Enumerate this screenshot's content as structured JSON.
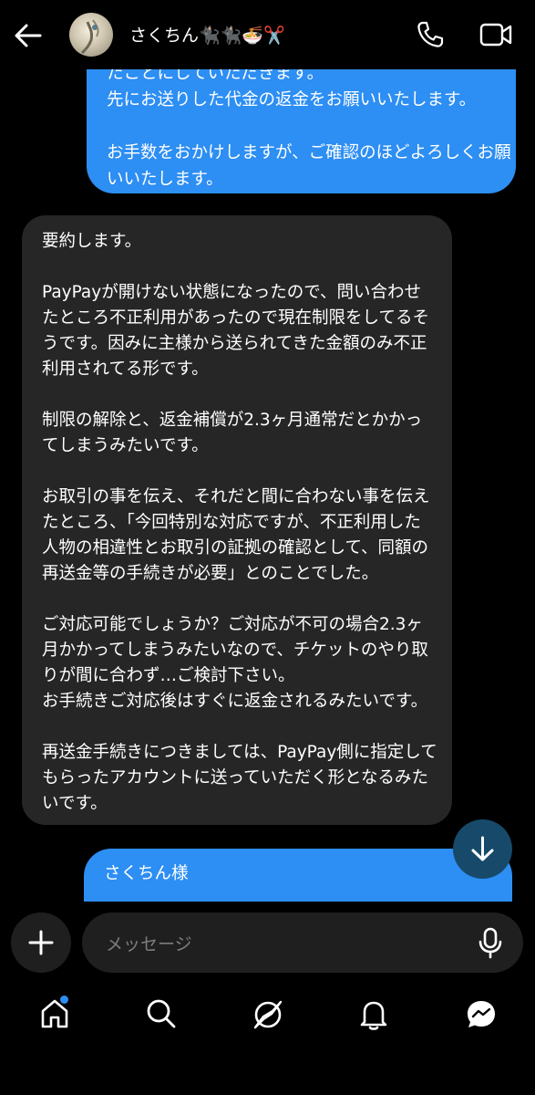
{
  "header": {
    "contact_name": "さくちん🐈‍⬛🐈‍⬛🍜✂️",
    "icons": [
      "back-arrow-icon",
      "avatar",
      "phone-icon",
      "video-icon"
    ]
  },
  "messages": {
    "outgoing_top": "たことにしていただきます。\n先にお送りした代金の返金をお願いいたします。\n\nお手数をおかけしますが、ご確認のほどよろしくお願いいたします。",
    "incoming": "要約します。\n\nPayPayが開けない状態になったので、問い合わせたところ不正利用があったので現在制限をしてるそうです。因みに主様から送られてきた金額のみ不正利用されてる形です。\n\n制限の解除と、返金補償が2.3ヶ月通常だとかかってしまうみたいです。\n\nお取引の事を伝え、それだと間に合わない事を伝えたところ、「今回特別な対応ですが、不正利用した人物の相違性とお取引の証拠の確認として、同額の再送金等の手続きが必要」とのことでした。\n\nご対応可能でしょうか？ご対応が不可の場合2.3ヶ月かかってしまうみたいなので、チケットのやり取りが間に合わず…ご検討下さい。\nお手続きご対応後はすぐに返金されるみたいです。\n\n再送金手続きにつきましては、PayPay側に指定してもらったアカウントに送っていただく形となるみたいです。",
    "outgoing_bottom": "さくちん様"
  },
  "composer": {
    "placeholder": "メッセージ"
  },
  "bottom_nav": {
    "items": [
      "home-icon",
      "search-icon",
      "explore-icon",
      "notifications-icon",
      "messages-icon"
    ],
    "home_has_badge": true
  },
  "colors": {
    "outgoing_bubble": "#2d8ef3",
    "incoming_bubble": "#262626",
    "background": "#000000"
  }
}
